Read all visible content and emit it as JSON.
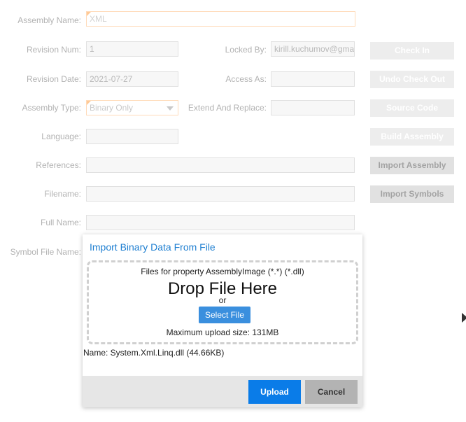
{
  "form": {
    "assembly_name_label": "Assembly Name:",
    "assembly_name_value": "XML",
    "revision_num_label": "Revision Num:",
    "revision_num_value": "1",
    "locked_by_label": "Locked By:",
    "locked_by_value": "kirill.kuchumov@gma",
    "revision_date_label": "Revision Date:",
    "revision_date_value": "2021-07-27",
    "access_as_label": "Access As:",
    "assembly_type_label": "Assembly Type:",
    "assembly_type_value": "Binary Only",
    "extend_replace_label": "Extend And Replace:",
    "language_label": "Language:",
    "references_label": "References:",
    "filename_label": "Filename:",
    "full_name_label": "Full Name:",
    "symbol_file_name_label": "Symbol File Name:"
  },
  "right_buttons": {
    "check_in": "Check In",
    "undo_check_out": "Undo Check Out",
    "source_code": "Source Code",
    "build_assembly": "Build Assembly",
    "import_assembly": "Import Assembly",
    "import_symbols": "Import Symbols"
  },
  "modal": {
    "title": "Import Binary Data From File",
    "files_for": "Files for property AssemblyImage (*.*) (*.dll)",
    "drop_text": "Drop File Here",
    "or_text": "or",
    "select_file": "Select File",
    "max_size": "Maximum upload size: 131MB",
    "file_name": "Name: System.Xml.Linq.dll (44.66KB)",
    "upload": "Upload",
    "cancel": "Cancel"
  },
  "colors": {
    "accent": "#0a7ce8",
    "required_marker": "#ff8c1a",
    "modal_title": "#1f7fd1"
  }
}
